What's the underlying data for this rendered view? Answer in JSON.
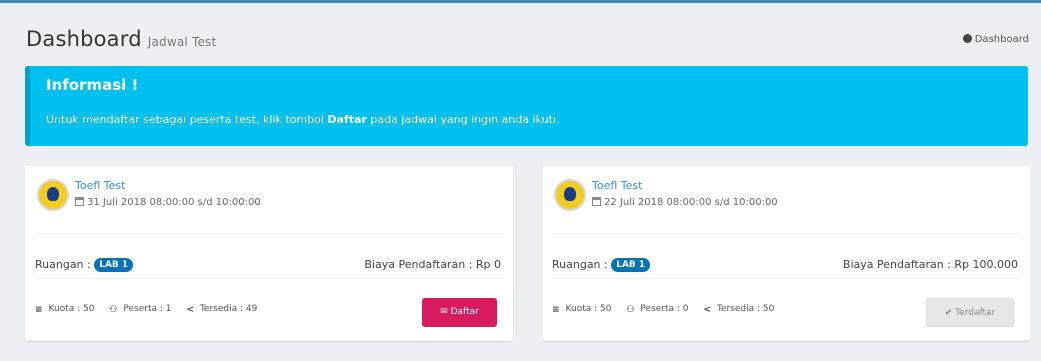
{
  "header": {
    "title": "Dashboard",
    "subtitle": "Jadwal Test",
    "breadcrumb": "Dashboard"
  },
  "info": {
    "heading": "Informasi !",
    "text_before": "Untuk mendaftar sebagai peserta test, klik tombol ",
    "text_bold": "Daftar",
    "text_after": " pada jadwal yang ingin anda ikuti."
  },
  "cards": [
    {
      "name": "Toefl Test",
      "date": "31 Juli 2018 08:00:00 s/d 10:00:00",
      "room_label": "Ruangan :",
      "room": "LAB 1",
      "fee": "Biaya Pendaftaran : Rp 0",
      "quota": "Kuota : 50",
      "participants": "Peserta : 1",
      "available": "Tersedia : 49",
      "button": "Daftar"
    },
    {
      "name": "Toefl Test",
      "date": "22 Juli 2018 08:00:00 s/d 10:00:00",
      "room_label": "Ruangan :",
      "room": "LAB 1",
      "fee": "Biaya Pendaftaran : Rp 100.000",
      "quota": "Kuota : 50",
      "participants": "Peserta : 0",
      "available": "Tersedia : 50",
      "button": "Terdaftar"
    }
  ],
  "colors": {
    "info": "#00c0ef",
    "daftar": "#d81b60",
    "badge": "#0073b7"
  }
}
